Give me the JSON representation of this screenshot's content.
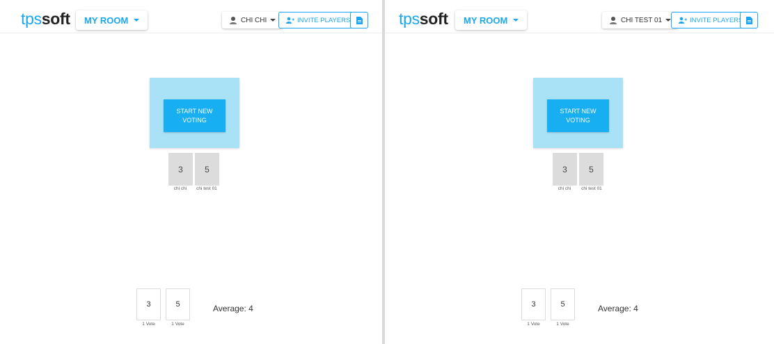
{
  "colors": {
    "brand": "#1aa6f0",
    "table": "#a9e1f7",
    "start_button": "#17aef2",
    "card": "#dcdcdc"
  },
  "left": {
    "header": {
      "logo_tps": "tps",
      "logo_soft": "soft",
      "room_label": "MY ROOM",
      "user_label": "CHI CHI",
      "invite_label": "INVITE PLAYERS",
      "icons": [
        "user-avatar-icon",
        "chevron-down-icon",
        "add-user-icon",
        "document-icon"
      ]
    },
    "table": {
      "start_label": "START NEW VOTING"
    },
    "players": [
      {
        "card": "3",
        "name": "chi chi"
      },
      {
        "card": "5",
        "name": "chi test 01"
      }
    ],
    "results": [
      {
        "value": "3",
        "votes": "1 Vote"
      },
      {
        "value": "5",
        "votes": "1 Vote"
      }
    ],
    "average": "Average: 4"
  },
  "right": {
    "header": {
      "logo_tps": "tps",
      "logo_soft": "soft",
      "room_label": "MY ROOM",
      "user_label": "CHI TEST 01",
      "invite_label": "INVITE PLAYERS",
      "icons": [
        "user-avatar-icon",
        "chevron-down-icon",
        "add-user-icon",
        "document-icon"
      ]
    },
    "table": {
      "start_label": "START NEW VOTING"
    },
    "players": [
      {
        "card": "3",
        "name": "chi chi"
      },
      {
        "card": "5",
        "name": "chi test 01"
      }
    ],
    "results": [
      {
        "value": "3",
        "votes": "1 Vote"
      },
      {
        "value": "5",
        "votes": "1 Vote"
      }
    ],
    "average": "Average: 4"
  }
}
